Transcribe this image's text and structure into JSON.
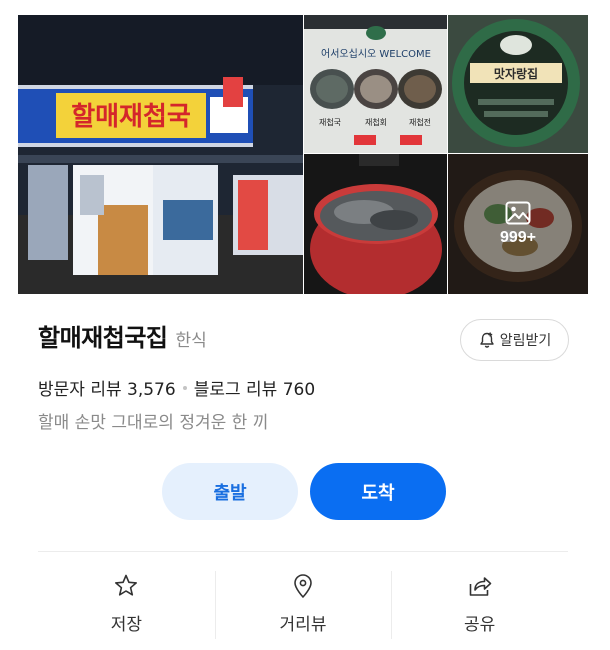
{
  "gallery": {
    "more_count": "999+",
    "sign_main": "할매재첩국",
    "sign_welcome": "어서오십시오 WELCOME",
    "sign_menu": [
      "재첩국",
      "재첩회",
      "재첩전"
    ],
    "sign_badge": "맛자랑집"
  },
  "place": {
    "name": "할매재첩국집",
    "category": "한식",
    "visitor_reviews": "방문자 리뷰 3,576",
    "blog_reviews": "블로그 리뷰 760",
    "description": "할매 손맛 그대로의 정겨운 한 끼"
  },
  "notify_label": "알림받기",
  "buttons": {
    "depart": "출발",
    "arrive": "도착"
  },
  "actions": [
    {
      "label": "저장"
    },
    {
      "label": "거리뷰"
    },
    {
      "label": "공유"
    }
  ],
  "colors": {
    "accent": "#0a6ef2",
    "accent_light": "#e5f0fd",
    "muted": "#8a8a8a"
  }
}
